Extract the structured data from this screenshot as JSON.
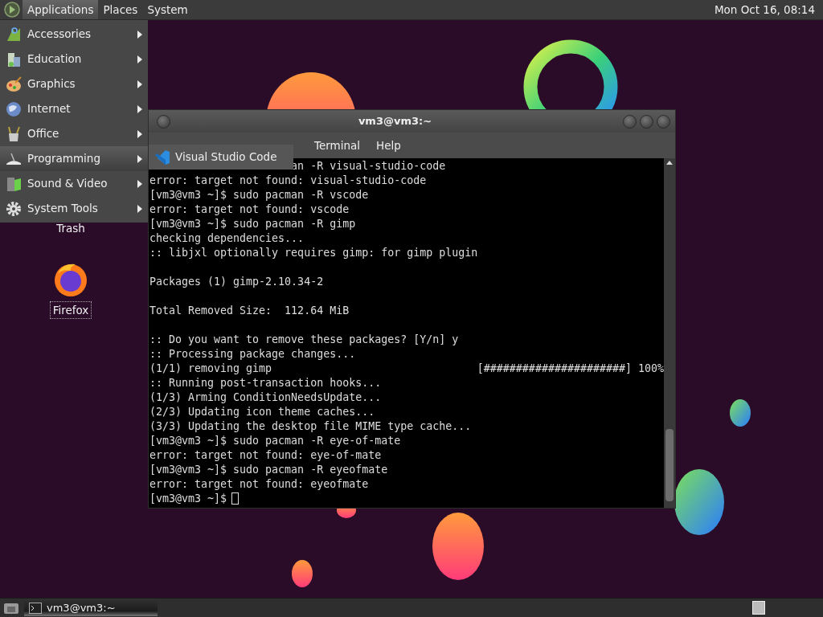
{
  "top_panel": {
    "menus": [
      {
        "label": "Applications",
        "selected": true
      },
      {
        "label": "Places",
        "selected": false
      },
      {
        "label": "System",
        "selected": false
      }
    ],
    "clock": "Mon Oct 16, 08:14"
  },
  "applications_menu": {
    "items": [
      {
        "label": "Accessories",
        "selected": false
      },
      {
        "label": "Education",
        "selected": false
      },
      {
        "label": "Graphics",
        "selected": false
      },
      {
        "label": "Internet",
        "selected": false
      },
      {
        "label": "Office",
        "selected": false
      },
      {
        "label": "Programming",
        "selected": true
      },
      {
        "label": "Sound & Video",
        "selected": false
      },
      {
        "label": "System Tools",
        "selected": false
      }
    ],
    "submenu": {
      "items": [
        {
          "label": "Visual Studio Code"
        }
      ]
    }
  },
  "desktop_icons": [
    {
      "label": "Trash",
      "selected": false,
      "kind": "trash"
    },
    {
      "label": "Firefox",
      "selected": true,
      "kind": "browser"
    }
  ],
  "terminal": {
    "title": "vm3@vm3:~",
    "menus": [
      "Terminal",
      "Help"
    ],
    "lines": [
      {
        "kind": "partial",
        "text": "an -R visual-studio-code"
      },
      {
        "kind": "text",
        "text": "error: target not found: visual-studio-code"
      },
      {
        "kind": "text",
        "text": "[vm3@vm3 ~]$ sudo pacman -R vscode"
      },
      {
        "kind": "text",
        "text": "error: target not found: vscode"
      },
      {
        "kind": "text",
        "text": "[vm3@vm3 ~]$ sudo pacman -R gimp"
      },
      {
        "kind": "text",
        "text": "checking dependencies..."
      },
      {
        "kind": "text",
        "text": ":: libjxl optionally requires gimp: for gimp plugin"
      },
      {
        "kind": "blank"
      },
      {
        "kind": "text",
        "text": "Packages (1) gimp-2.10.34-2"
      },
      {
        "kind": "blank"
      },
      {
        "kind": "text",
        "text": "Total Removed Size:  112.64 MiB"
      },
      {
        "kind": "blank"
      },
      {
        "kind": "text",
        "text": ":: Do you want to remove these packages? [Y/n] y"
      },
      {
        "kind": "text",
        "text": ":: Processing package changes..."
      },
      {
        "kind": "progress",
        "text": "(1/1) removing gimp",
        "bar": "[######################]",
        "percent": "100%"
      },
      {
        "kind": "text",
        "text": ":: Running post-transaction hooks..."
      },
      {
        "kind": "text",
        "text": "(1/3) Arming ConditionNeedsUpdate..."
      },
      {
        "kind": "text",
        "text": "(2/3) Updating icon theme caches..."
      },
      {
        "kind": "text",
        "text": "(3/3) Updating the desktop file MIME type cache..."
      },
      {
        "kind": "text",
        "text": "[vm3@vm3 ~]$ sudo pacman -R eye-of-mate"
      },
      {
        "kind": "text",
        "text": "error: target not found: eye-of-mate"
      },
      {
        "kind": "text",
        "text": "[vm3@vm3 ~]$ sudo pacman -R eyeofmate"
      },
      {
        "kind": "text",
        "text": "error: target not found: eyeofmate"
      },
      {
        "kind": "prompt",
        "text": "[vm3@vm3 ~]$"
      }
    ]
  },
  "taskbar": {
    "tasks": [
      {
        "label": "vm3@vm3:~",
        "selected": true
      }
    ]
  }
}
